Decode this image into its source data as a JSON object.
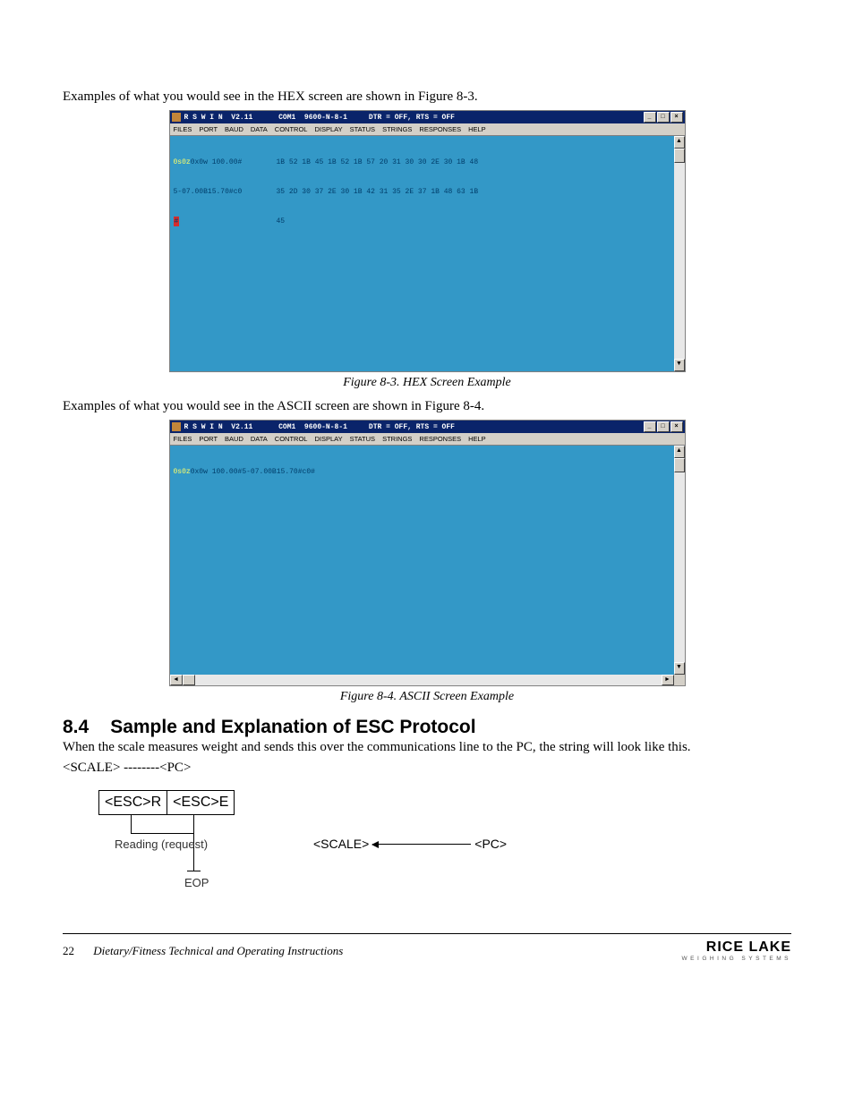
{
  "intro1": "Examples of what you would see in the HEX screen are shown in Figure 8-3.",
  "intro2": "Examples of what you would see in the ASCII  screen are shown in Figure 8-4.",
  "window": {
    "title": "R S W I N  V2.11      COM1  9600-N-8-1     DTR = OFF, RTS = OFF",
    "menu": [
      "FILES",
      "PORT",
      "BAUD",
      "DATA",
      "CONTROL",
      "DISPLAY",
      "STATUS",
      "STRINGS",
      "RESPONSES",
      "HELP"
    ],
    "buttons": {
      "min": "_",
      "max": "□",
      "close": "×"
    }
  },
  "hex": {
    "left1_a": "0s0z",
    "left1_b": "0x0w 100.00#",
    "left2": "5-07.00B15.70#c0",
    "left3": "#",
    "hex1": "1B 52 1B 45 1B 52 1B 57 20 31 30 30 2E 30 1B 48",
    "hex2": "35 2D 30 37 2E 30 1B 42 31 35 2E 37 1B 48 63 1B",
    "hex3": "45"
  },
  "ascii": {
    "line_a": "0s0z",
    "line_b": "0x0w 100.00#5-07.00B15.70#c0#"
  },
  "fig1_caption": "Figure 8-3. HEX Screen Example",
  "fig2_caption": "Figure 8-4. ASCII Screen Example",
  "section": {
    "num": "8.4",
    "title": "Sample and Explanation of ESC Protocol"
  },
  "para1": "When the scale measures weight and sends this over the communications line to the PC, the string will look like this.",
  "para2": "<SCALE> --------<PC>",
  "diagram": {
    "esc1": "<ESC>R",
    "esc2": "<ESC>E",
    "reading": "Reading\n(request)",
    "eop": "EOP",
    "scale": "<SCALE>",
    "pc": "<PC>"
  },
  "footer": {
    "page": "22",
    "title": "Dietary/Fitness Technical and Operating Instructions",
    "logo": "RICE LAKE",
    "logo_sub": "WEIGHING SYSTEMS"
  }
}
